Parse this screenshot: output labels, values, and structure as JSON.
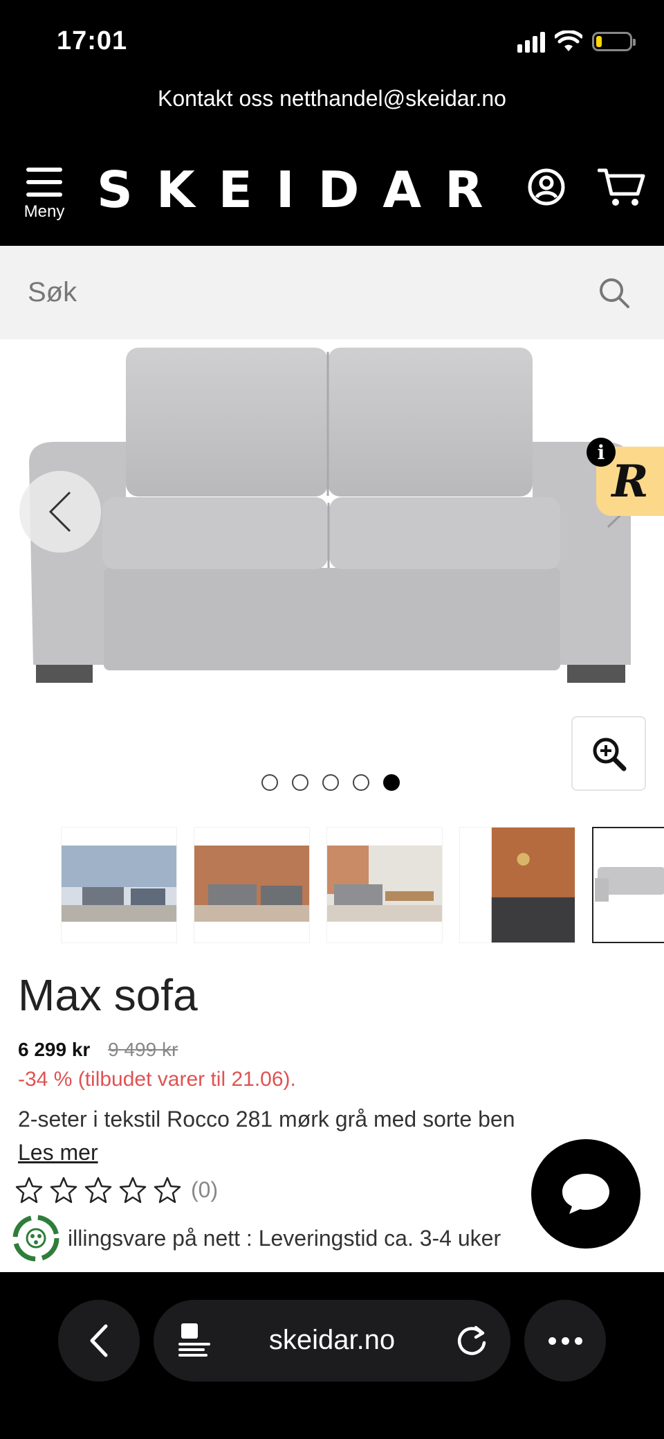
{
  "status_bar": {
    "time": "17:01"
  },
  "contact": {
    "text": "Kontakt oss netthandel@skeidar.no"
  },
  "header": {
    "logo": "SKEIDAR",
    "menu_label": "Meny"
  },
  "search": {
    "placeholder": "Søk"
  },
  "gallery": {
    "total_images": 5,
    "active_index": 5,
    "badge_letter": "R",
    "info_letter": "i"
  },
  "product": {
    "title": "Max sofa",
    "price": "6 299 kr",
    "old_price": "9 499 kr",
    "discount": "-34 % (tilbudet varer til 21.06).",
    "description": "2-seter i tekstil Rocco 281 mørk grå med sorte ben",
    "read_more": "Les mer",
    "rating_stars": 0,
    "rating_count": "(0)",
    "delivery": "illingsvare på nett : Leveringstid ca. 3-4 uker"
  },
  "browser": {
    "url": "skeidar.no"
  },
  "colors": {
    "accent_red": "#e05252",
    "badge_yellow": "#fcd98a",
    "sofa_grey": "#c6c6c8"
  }
}
